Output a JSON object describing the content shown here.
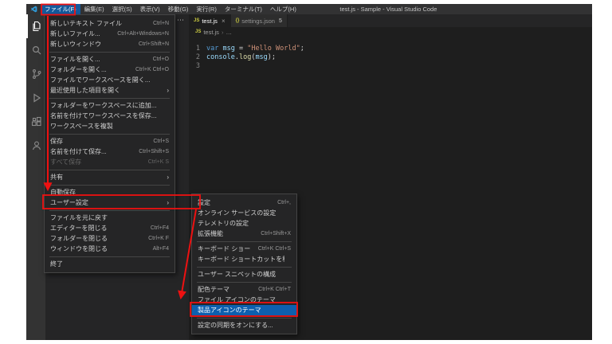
{
  "colors": {
    "annotation": "#ee1111",
    "menu-selection": "#0d5fae",
    "keyword": "#569cd6",
    "variable": "#9cdcfe",
    "string": "#ce9178",
    "func": "#dcdcaa",
    "plain": "#d4d4d4"
  },
  "glyphs": {
    "submenu_arrow": "›"
  },
  "titlebar": {
    "title": "test.js - Sample - Visual Studio Code",
    "menus": [
      {
        "label": "ファイル(F)",
        "active": true
      },
      {
        "label": "編集(E)"
      },
      {
        "label": "選択(S)"
      },
      {
        "label": "表示(V)"
      },
      {
        "label": "移動(G)"
      },
      {
        "label": "実行(R)"
      },
      {
        "label": "ターミナル(T)"
      },
      {
        "label": "ヘルプ(H)"
      }
    ]
  },
  "activity_bar": {
    "items": [
      "explorer-icon",
      "search-icon",
      "source-control-icon",
      "run-debug-icon",
      "extensions-icon",
      "account-icon"
    ]
  },
  "sidebar": {
    "more_actions": "⋯"
  },
  "file_menu": {
    "items": [
      {
        "label": "新しいテキスト ファイル",
        "shortcut": "Ctrl+N"
      },
      {
        "label": "新しいファイル...",
        "shortcut": "Ctrl+Alt+Windows+N"
      },
      {
        "label": "新しいウィンドウ",
        "shortcut": "Ctrl+Shift+N"
      },
      {
        "type": "separator"
      },
      {
        "label": "ファイルを開く...",
        "shortcut": "Ctrl+O"
      },
      {
        "label": "フォルダーを開く...",
        "shortcut": "Ctrl+K Ctrl+O"
      },
      {
        "label": "ファイルでワークスペースを開く..."
      },
      {
        "label": "最近使用した項目を開く",
        "submenu": true
      },
      {
        "type": "separator"
      },
      {
        "label": "フォルダーをワークスペースに追加..."
      },
      {
        "label": "名前を付けてワークスペースを保存..."
      },
      {
        "label": "ワークスペースを複製"
      },
      {
        "type": "separator"
      },
      {
        "label": "保存",
        "shortcut": "Ctrl+S"
      },
      {
        "label": "名前を付けて保存...",
        "shortcut": "Ctrl+Shift+S"
      },
      {
        "label": "すべて保存",
        "shortcut": "Ctrl+K S",
        "disabled": true
      },
      {
        "type": "separator"
      },
      {
        "label": "共有",
        "submenu": true
      },
      {
        "type": "separator"
      },
      {
        "label": "自動保存"
      },
      {
        "label": "ユーザー設定",
        "submenu": true,
        "annotated": true
      },
      {
        "type": "separator"
      },
      {
        "label": "ファイルを元に戻す"
      },
      {
        "label": "エディターを閉じる",
        "shortcut": "Ctrl+F4"
      },
      {
        "label": "フォルダーを閉じる",
        "shortcut": "Ctrl+K F"
      },
      {
        "label": "ウィンドウを閉じる",
        "shortcut": "Alt+F4"
      },
      {
        "type": "separator"
      },
      {
        "label": "終了"
      }
    ]
  },
  "settings_submenu": {
    "items": [
      {
        "label": "設定",
        "shortcut": "Ctrl+,"
      },
      {
        "label": "オンライン サービスの設定"
      },
      {
        "label": "テレメトリの設定"
      },
      {
        "label": "拡張機能",
        "shortcut": "Ctrl+Shift+X"
      },
      {
        "type": "separator"
      },
      {
        "label": "キーボード ショートカット",
        "shortcut": "Ctrl+K Ctrl+S"
      },
      {
        "label": "キーボード ショートカットを移行する..."
      },
      {
        "type": "separator"
      },
      {
        "label": "ユーザー スニペットの構成"
      },
      {
        "type": "separator"
      },
      {
        "label": "配色テーマ",
        "shortcut": "Ctrl+K Ctrl+T"
      },
      {
        "label": "ファイル アイコンのテーマ"
      },
      {
        "label": "製品アイコンのテーマ",
        "highlighted": true,
        "annotated": true
      },
      {
        "type": "separator"
      },
      {
        "label": "設定の同期をオンにする..."
      }
    ]
  },
  "editor": {
    "tabs": [
      {
        "icon": "JS",
        "label": "test.js",
        "close": "×",
        "active": true
      },
      {
        "icon": "{}",
        "label": "settings.json",
        "badge": "5",
        "active": false
      }
    ],
    "breadcrumb": {
      "icon": "JS",
      "file": "test.js",
      "separator": "›",
      "more": "…"
    },
    "code": {
      "line_numbers": [
        "1",
        "2",
        "3"
      ],
      "line1": [
        "var",
        " ",
        "msg",
        " = ",
        "\"Hello World\"",
        ";"
      ],
      "line2": [
        "console",
        ".",
        "log",
        "(",
        "msg",
        ");"
      ]
    }
  }
}
